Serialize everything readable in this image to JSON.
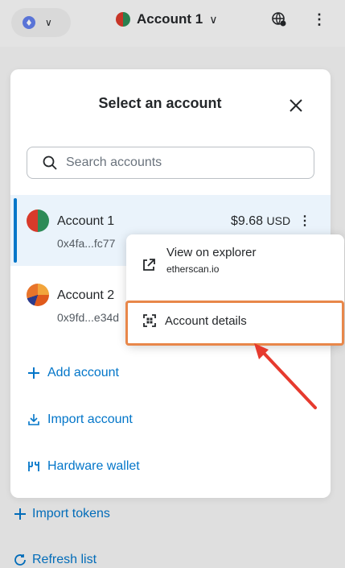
{
  "topbar": {
    "account_name": "Account 1",
    "network_icon": "ethereum-icon",
    "chevron": "chevron-down-icon",
    "globe_icon": "globe-icon",
    "menu_icon": "kebab-menu-icon"
  },
  "background": {
    "import_tokens": "Import tokens",
    "refresh_list": "Refresh list"
  },
  "modal": {
    "title": "Select an account",
    "search_placeholder": "Search accounts",
    "accounts": [
      {
        "name": "Account 1",
        "address": "0x4fa...fc77",
        "balance": "$9.68",
        "currency": "USD",
        "selected": true
      },
      {
        "name": "Account 2",
        "address": "0x9fd...e34d",
        "selected": false
      }
    ],
    "actions": {
      "add_account": "Add account",
      "import_account": "Import account",
      "hardware_wallet": "Hardware wallet"
    }
  },
  "menu": {
    "view_explorer": "View on explorer",
    "explorer_sub": "etherscan.io",
    "account_details": "Account details"
  },
  "colors": {
    "link": "#0376c9",
    "highlight": "#e8874a",
    "arrow": "#e63a2e"
  }
}
